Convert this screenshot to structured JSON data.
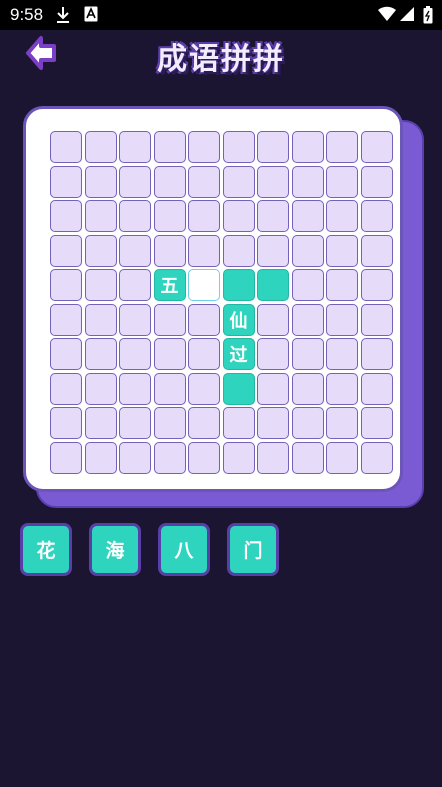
{
  "status_bar": {
    "time": "9:58"
  },
  "header": {
    "title": "成语拼拼"
  },
  "board": {
    "rows": 10,
    "cols": 10,
    "cells": [
      {
        "row": 4,
        "col": 3,
        "state": "filled",
        "char": "五"
      },
      {
        "row": 4,
        "col": 4,
        "state": "selected",
        "char": ""
      },
      {
        "row": 4,
        "col": 5,
        "state": "filled",
        "char": ""
      },
      {
        "row": 4,
        "col": 6,
        "state": "filled",
        "char": ""
      },
      {
        "row": 5,
        "col": 5,
        "state": "filled",
        "char": "仙"
      },
      {
        "row": 6,
        "col": 5,
        "state": "filled",
        "char": "过"
      },
      {
        "row": 7,
        "col": 5,
        "state": "filled",
        "char": ""
      }
    ]
  },
  "choices": [
    {
      "label": "花"
    },
    {
      "label": "海"
    },
    {
      "label": "八"
    },
    {
      "label": "门"
    }
  ],
  "colors": {
    "background": "#1b1532",
    "cell_empty": "#e6dcfa",
    "cell_filled": "#2fd4be",
    "accent_purple": "#7b5bd3"
  }
}
